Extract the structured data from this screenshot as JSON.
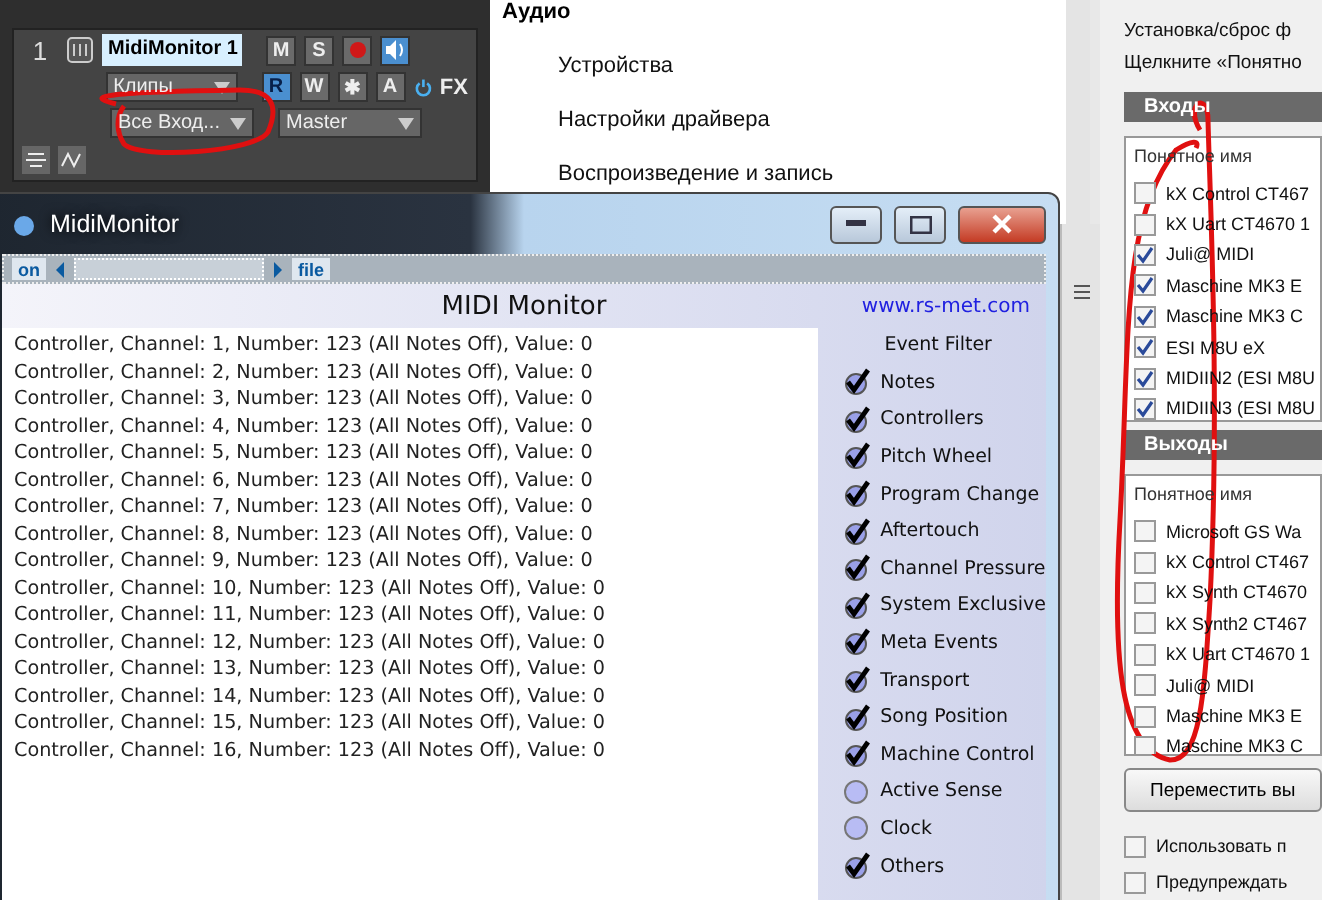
{
  "daw_track": {
    "number": "1",
    "name": "MidiMonitor 1",
    "mute": "M",
    "solo": "S",
    "record_armed": true,
    "input_echo_on": true,
    "automation": [
      {
        "label": "R",
        "on": true
      },
      {
        "label": "W",
        "on": false
      },
      {
        "label": "✱",
        "on": false
      },
      {
        "label": "A",
        "on": false
      }
    ],
    "clips_dropdown": "Клипы",
    "input_dropdown": "Все Вход...",
    "output_dropdown": "Master",
    "fx_on": true,
    "fx_label": "FX"
  },
  "settings_menu": {
    "heading": "Аудио",
    "items": [
      "Устройства",
      "Настройки драйвера",
      "Воспроизведение и запись"
    ]
  },
  "midi_monitor": {
    "title": "MidiMonitor",
    "toolbar": {
      "power_label": "on",
      "file_label": "file"
    },
    "heading": "MIDI Monitor",
    "link": "www.rs-met.com",
    "log": [
      "Controller, Channel: 1, Number: 123 (All Notes Off), Value: 0",
      "Controller, Channel: 2, Number: 123 (All Notes Off), Value: 0",
      "Controller, Channel: 3, Number: 123 (All Notes Off), Value: 0",
      "Controller, Channel: 4, Number: 123 (All Notes Off), Value: 0",
      "Controller, Channel: 5, Number: 123 (All Notes Off), Value: 0",
      "Controller, Channel: 6, Number: 123 (All Notes Off), Value: 0",
      "Controller, Channel: 7, Number: 123 (All Notes Off), Value: 0",
      "Controller, Channel: 8, Number: 123 (All Notes Off), Value: 0",
      "Controller, Channel: 9, Number: 123 (All Notes Off), Value: 0",
      "Controller, Channel: 10, Number: 123 (All Notes Off), Value: 0",
      "Controller, Channel: 11, Number: 123 (All Notes Off), Value: 0",
      "Controller, Channel: 12, Number: 123 (All Notes Off), Value: 0",
      "Controller, Channel: 13, Number: 123 (All Notes Off), Value: 0",
      "Controller, Channel: 14, Number: 123 (All Notes Off), Value: 0",
      "Controller, Channel: 15, Number: 123 (All Notes Off), Value: 0",
      "Controller, Channel: 16, Number: 123 (All Notes Off), Value: 0"
    ],
    "filter_title": "Event Filter",
    "filters": [
      {
        "label": "Notes",
        "checked": true
      },
      {
        "label": "Controllers",
        "checked": true
      },
      {
        "label": "Pitch Wheel",
        "checked": true
      },
      {
        "label": "Program Change",
        "checked": true
      },
      {
        "label": "Aftertouch",
        "checked": true
      },
      {
        "label": "Channel Pressure",
        "checked": true
      },
      {
        "label": "System Exclusive",
        "checked": true
      },
      {
        "label": "Meta Events",
        "checked": true
      },
      {
        "label": "Transport",
        "checked": true
      },
      {
        "label": "Song Position",
        "checked": true
      },
      {
        "label": "Machine Control",
        "checked": true
      },
      {
        "label": "Active Sense",
        "checked": false
      },
      {
        "label": "Clock",
        "checked": false
      },
      {
        "label": "Others",
        "checked": true
      }
    ]
  },
  "midi_devices": {
    "intro": [
      "Установка/сброс ф",
      "Щелкните «Понятно"
    ],
    "inputs": {
      "header": "Входы",
      "column": "Понятное имя",
      "items": [
        {
          "label": "kX Control CT467",
          "checked": false
        },
        {
          "label": "kX Uart CT4670 1",
          "checked": false
        },
        {
          "label": "Juli@ MIDI",
          "checked": true
        },
        {
          "label": "Maschine MK3 E",
          "checked": true
        },
        {
          "label": "Maschine MK3 C",
          "checked": true
        },
        {
          "label": "ESI M8U eX",
          "checked": true
        },
        {
          "label": "MIDIIN2 (ESI M8U",
          "checked": true
        },
        {
          "label": "MIDIIN3 (ESI M8U",
          "checked": true
        }
      ]
    },
    "outputs": {
      "header": "Выходы",
      "column": "Понятное имя",
      "items": [
        {
          "label": "Microsoft GS Wa",
          "checked": false
        },
        {
          "label": "kX Control CT467",
          "checked": false
        },
        {
          "label": "kX Synth CT4670",
          "checked": false
        },
        {
          "label": "kX Synth2 CT467",
          "checked": false
        },
        {
          "label": "kX Uart CT4670 1",
          "checked": false
        },
        {
          "label": "Juli@ MIDI",
          "checked": false
        },
        {
          "label": "Maschine MK3 E",
          "checked": false
        },
        {
          "label": "Maschine MK3 C",
          "checked": false
        }
      ]
    },
    "move_button": "Переместить вы",
    "options": [
      {
        "label": "Использовать п",
        "checked": false
      },
      {
        "label": "Предупреждать",
        "checked": false
      }
    ]
  }
}
